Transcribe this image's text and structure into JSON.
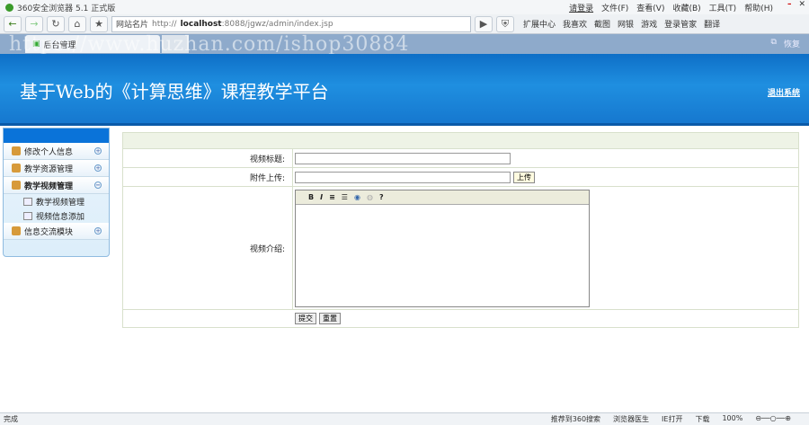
{
  "browser": {
    "title": "360安全浏览器 5.1 正式版",
    "login": "请登录",
    "menus": [
      "文件(F)",
      "查看(V)",
      "收藏(B)",
      "工具(T)",
      "帮助(H)"
    ],
    "url_prefix": "http://",
    "url_host": "localhost",
    "url_rest": ":8088/jgwz/admin/index.jsp",
    "site_card": "网站名片",
    "extensions": [
      "扩展中心",
      "我喜欢",
      "截图",
      "网银",
      "游戏",
      "登录管家",
      "翻译"
    ],
    "tab_label": "后台管理",
    "restore": "恢复",
    "watermark": "https://www.huzhan.com/ishop30884"
  },
  "header": {
    "title": "基于Web的《计算思维》课程教学平台",
    "logout": "退出系统"
  },
  "sidebar": {
    "items": [
      {
        "label": "修改个人信息",
        "toggle": "+"
      },
      {
        "label": "教学资源管理",
        "toggle": "+"
      },
      {
        "label": "教学视频管理",
        "toggle": "−"
      },
      {
        "label": "信息交流模块",
        "toggle": "+"
      }
    ],
    "subitems": [
      "教学视频管理",
      "视频信息添加"
    ]
  },
  "form": {
    "title_label": "视频标题:",
    "title_value": "",
    "attach_label": "附件上传:",
    "upload": "上传",
    "intro_label": "视频介绍:",
    "editor_tools": [
      "B",
      "I",
      "≡",
      "☰",
      "◉",
      "◍",
      "?"
    ],
    "submit": "提交",
    "reset": "重置"
  },
  "status": {
    "left": "完成",
    "items": [
      "推荐到360搜索",
      "浏览器医生",
      "IE打开",
      "下载",
      "100%"
    ]
  }
}
